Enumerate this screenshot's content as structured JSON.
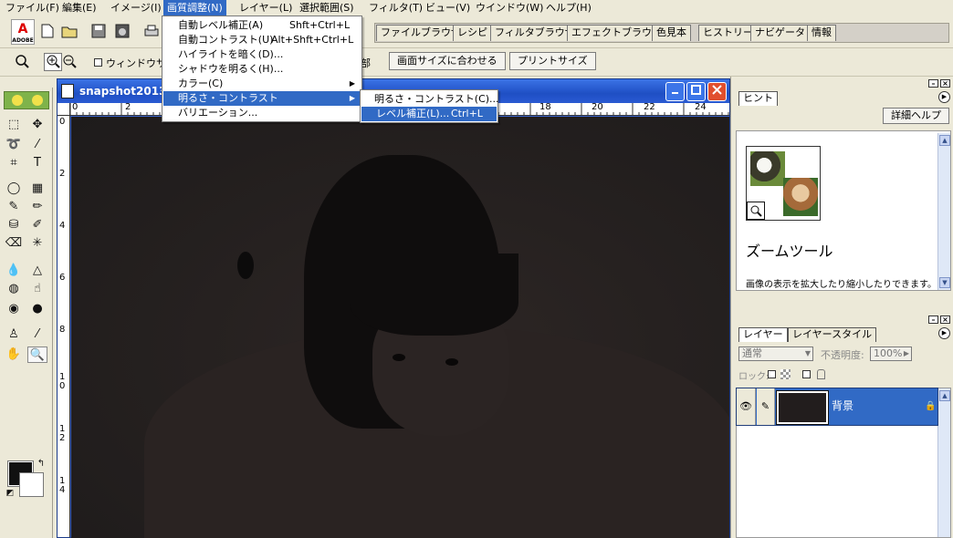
{
  "menubar": {
    "items": [
      "ファイル(F)",
      "編集(E)",
      "イメージ(I)",
      "画質調整(N)",
      "レイヤー(L)",
      "選択範囲(S)",
      "フィルタ(T)",
      "ビュー(V)",
      "ウインドウ(W)",
      "ヘルプ(H)"
    ],
    "active": "画質調整(N)"
  },
  "adobe_logo": {
    "letter": "A",
    "text": "ADOBE"
  },
  "palette_well": {
    "tabs": [
      "ファイルブラウザ",
      "レシピ",
      "フィルタブラウザ",
      "エフェクトブラウザ",
      "色見本",
      "ヒストリー",
      "ナビゲータ",
      "情報"
    ]
  },
  "options_bar": {
    "window_size_label": "ウィンドウサイ",
    "fit_screen_partial": "部",
    "fit_screen_label": "画面サイズに合わせる",
    "print_size_label": "プリントサイズ"
  },
  "adjust_menu": {
    "items": [
      {
        "label": "自動レベル補正(A)",
        "shortcut": "Shft+Ctrl+L"
      },
      {
        "label": "自動コントラスト(U)",
        "shortcut": "Alt+Shft+Ctrl+L"
      },
      {
        "label": "ハイライトを暗く(D)...",
        "shortcut": ""
      },
      {
        "label": "シャドウを明るく(H)...",
        "shortcut": ""
      },
      {
        "label": "カラー(C)",
        "shortcut": ""
      },
      {
        "label": "明るさ・コントラスト",
        "shortcut": ""
      },
      {
        "label": "バリエーション...",
        "shortcut": ""
      }
    ],
    "highlighted": "明るさ・コントラスト"
  },
  "brightness_submenu": {
    "items": [
      {
        "label": "明るさ・コントラスト(C)...",
        "shortcut": ""
      },
      {
        "label": "レベル補正(L)...",
        "shortcut": "Ctrl+L"
      }
    ],
    "highlighted": "レベル補正(L)..."
  },
  "document_window": {
    "title": "snapshot2013",
    "ruler_top": [
      "0",
      "2",
      "18",
      "20",
      "22",
      "24"
    ],
    "ruler_left": [
      "0",
      "2",
      "4",
      "6",
      "8",
      "1\n0",
      "1\n2",
      "1\n4"
    ]
  },
  "hint_palette": {
    "tab": "ヒント",
    "detail_button": "詳細ヘルプ",
    "title": "ズームツール",
    "description": "画像の表示を拡大したり縮小したりできます。"
  },
  "layers_palette": {
    "tabs": [
      "レイヤー",
      "レイヤースタイル"
    ],
    "blend_mode": "通常",
    "opacity_label": "不透明度:",
    "opacity_value": "100%",
    "lock_label": "ロック:",
    "layer_name": "背景"
  },
  "colors": {
    "accent": "#316ac5",
    "titlebar": "#2456d4",
    "foreground": "#111111",
    "background": "#ffffff"
  }
}
